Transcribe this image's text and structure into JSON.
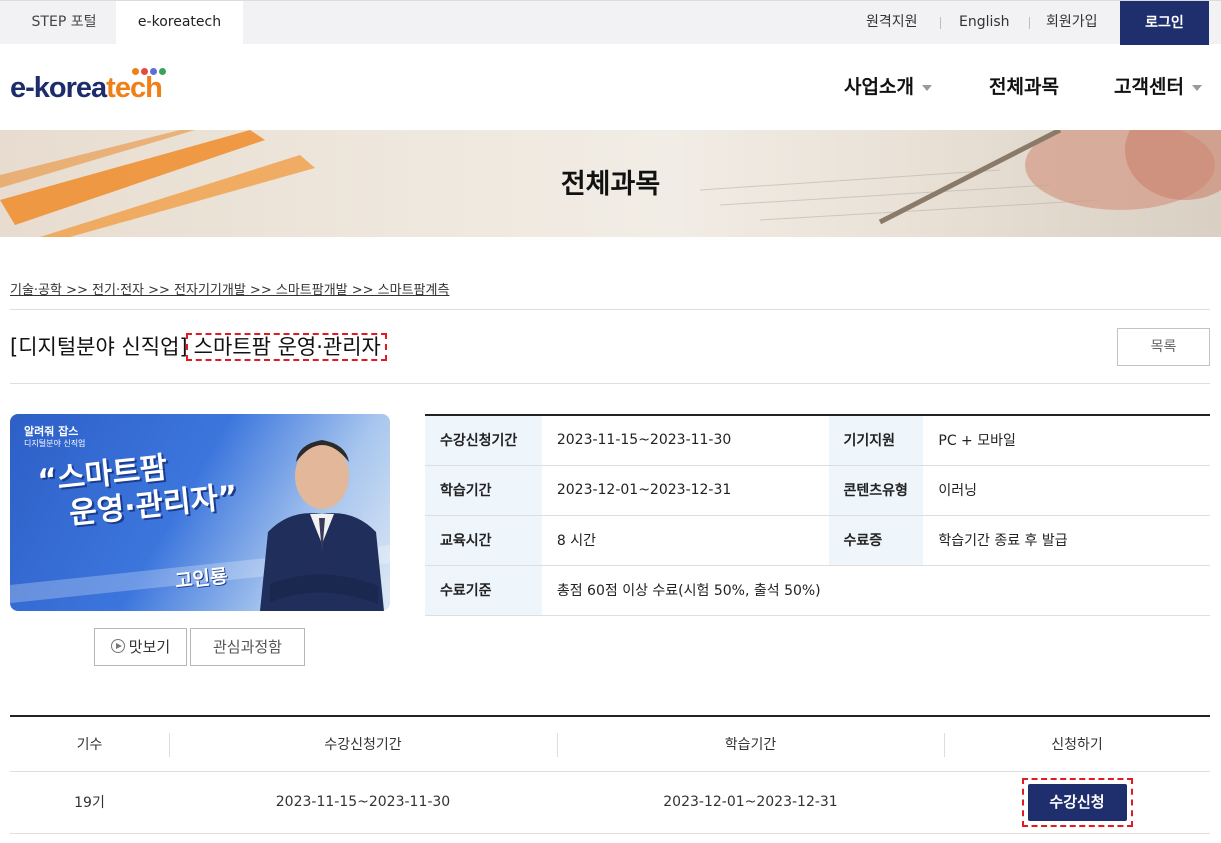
{
  "topbar": {
    "tabs": [
      {
        "label": "STEP 포털"
      },
      {
        "label": "e-koreatech"
      }
    ],
    "remote_support": "원격지원",
    "english": "English",
    "signup": "회원가입",
    "login": "로그인"
  },
  "logo": {
    "text_main": "e-korea",
    "text_accent": "tech",
    "dot_colors": [
      "#f07f17",
      "#e6493f",
      "#5b6fd8",
      "#3aa35b"
    ]
  },
  "gnb": {
    "items": [
      {
        "label": "사업소개",
        "has_dropdown": true
      },
      {
        "label": "전체과목",
        "has_dropdown": false
      },
      {
        "label": "고객센터",
        "has_dropdown": true
      }
    ]
  },
  "banner": {
    "title": "전체과목"
  },
  "breadcrumb": "기술·공학 >> 전기·전자 >> 전자기기개발 >> 스마트팜개발 >> 스마트팜계측",
  "course": {
    "prefix": "[디지털분야 신직업]",
    "name": "스마트팜 운영·관리자",
    "list_button": "목록"
  },
  "thumbnail": {
    "brand_line1": "알려줘 잡스",
    "brand_line2": "디지털분야 신직업",
    "headline_line1": "“스마트팜",
    "headline_line2": "운영·관리자”",
    "instructor": "고인룡"
  },
  "buttons": {
    "preview": "맛보기",
    "favorite": "관심과정함"
  },
  "info": {
    "rows": [
      {
        "k1": "수강신청기간",
        "v1": "2023-11-15~2023-11-30",
        "k2": "기기지원",
        "v2": "PC + 모바일"
      },
      {
        "k1": "학습기간",
        "v1": "2023-12-01~2023-12-31",
        "k2": "콘텐츠유형",
        "v2": "이러닝"
      },
      {
        "k1": "교육시간",
        "v1": "8 시간",
        "k2": "수료증",
        "v2": "학습기간 종료 후 발급"
      }
    ],
    "criteria_label": "수료기준",
    "criteria_value": "총점 60점 이상 수료(시험 50%, 출석 50%)"
  },
  "sessions": {
    "headers": [
      "기수",
      "수강신청기간",
      "학습기간",
      "신청하기"
    ],
    "rows": [
      {
        "term": "19기",
        "apply_period": "2023-11-15~2023-11-30",
        "study_period": "2023-12-01~2023-12-31",
        "action": "수강신청"
      }
    ]
  },
  "colors": {
    "primary_navy": "#1f2f6e",
    "accent_orange": "#f07f17",
    "highlight_red": "#e01b24"
  }
}
